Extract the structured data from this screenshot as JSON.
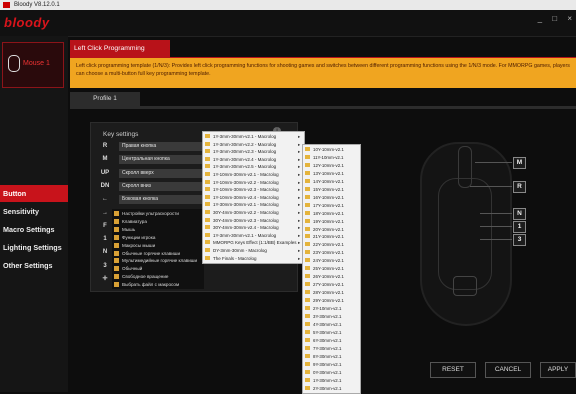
{
  "window": {
    "title": "Bloody V8.12.0.1"
  },
  "app": {
    "logo": "bloody",
    "controls": [
      "_",
      "□",
      "×"
    ]
  },
  "device": {
    "label": "Mouse 1"
  },
  "sidebar": {
    "items": [
      {
        "label": "Button",
        "active": true
      },
      {
        "label": "Sensitivity",
        "active": false
      },
      {
        "label": "Macro Settings",
        "active": false
      },
      {
        "label": "Lighting Settings",
        "active": false
      },
      {
        "label": "Other Settings",
        "active": false
      }
    ]
  },
  "header": {
    "title": "Left Click Programming"
  },
  "notice": {
    "text": "Left click programming template (1/N/3): Provides left click programming functions for shooting games and switches between different programming functions using the 1/N/3 mode. For MMORPG games, players can choose a multi-button full key programming template."
  },
  "profile": {
    "tab": "Profile 1"
  },
  "key_settings": {
    "title": "Key settings",
    "info": "i",
    "rows": [
      {
        "key": "R",
        "value": "Правая кнопка"
      },
      {
        "key": "M",
        "value": "Центральная кнопка"
      },
      {
        "key": "UP",
        "value": "Скролл вверх"
      },
      {
        "key": "DN",
        "value": "Скролл вниз"
      },
      {
        "key": "←",
        "value": "Боковая кнопка"
      },
      {
        "key": "→",
        "value": "Боковая кнопка"
      },
      {
        "key": "F",
        "value": ""
      },
      {
        "key": "1",
        "value": ""
      },
      {
        "key": "N",
        "value": ""
      },
      {
        "key": "3",
        "value": ""
      },
      {
        "key": "✛",
        "value": ""
      }
    ]
  },
  "submenu": {
    "items": [
      "Настройки ультраскорости",
      "Клавиатура",
      "Мышь",
      "Функции игрока",
      "Макросы мыши",
      "Обычные горячие клавиши",
      "Мультимедийные горячие клавиши",
      "Обычный",
      "Свободное вращение",
      "Выбрать файл с макросом"
    ]
  },
  "dropdown1": {
    "items": [
      "1Y-3mm-30mm-v2.1 - Macrolog",
      "1Y-3mm-30mm-v2.2 - Macrolog",
      "1Y-3mm-30mm-v2.3 - Macrolog",
      "1Y-3mm-30mm-v2.4 - Macrolog",
      "1Y-3mm-30mm-v2.5 - Macrolog",
      "1Y-10mm-30mm-v2.1 - Macrolog",
      "1Y-10mm-30mm-v2.2 - Macrolog",
      "1Y-10mm-30mm-v2.3 - Macrolog",
      "1Y-10mm-30mm-v2.4 - Macrolog",
      "1Y-30mm-30mm-v2.1 - Macrolog",
      "30Y-4mm-30mm-v2.2 - Macrolog",
      "30Y-4mm-30mm-v2.3 - Macrolog",
      "30Y-4mm-30mm-v2.4 - Macrolog",
      "1Y-3mm-30mm-v2.1 - Macrolog",
      "MMORPG Keys Effect (1:1/BB) Examples",
      "DY-3mm-30mm - Macrolog",
      "The Finals - Macrolog"
    ]
  },
  "dropdown2": {
    "items": [
      "10Y-10mm-v2.1",
      "11Y-10mm-v2.1",
      "12Y-10mm-v2.1",
      "13Y-10mm-v2.1",
      "14Y-10mm-v2.1",
      "15Y-10mm-v2.1",
      "16Y-10mm-v2.1",
      "17Y-10mm-v2.1",
      "18Y-10mm-v2.1",
      "19Y-10mm-v2.1",
      "20Y-10mm-v2.1",
      "21Y-10mm-v2.1",
      "22Y-10mm-v2.1",
      "23Y-10mm-v2.1",
      "24Y-10mm-v2.1",
      "25Y-10mm-v2.1",
      "26Y-10mm-v2.1",
      "27Y-10mm-v2.1",
      "28Y-10mm-v2.1",
      "29Y-10mm-v2.1",
      "2Y-10mm-v2.1",
      "3Y-30mm-v2.1",
      "4Y-30mm-v2.1",
      "5Y-30mm-v2.1",
      "6Y-30mm-v2.1",
      "7Y-30mm-v2.1",
      "8Y-30mm-v2.1",
      "9Y-30mm-v2.1",
      "0Y-30mm-v2.1",
      "1Y-30mm-v2.1",
      "2Y-30mm-v2.1"
    ]
  },
  "callouts": [
    "M",
    "R",
    "N",
    "1",
    "3"
  ],
  "buttons": {
    "reset": "RESET",
    "cancel": "CANCEL",
    "apply": "APPLY"
  }
}
